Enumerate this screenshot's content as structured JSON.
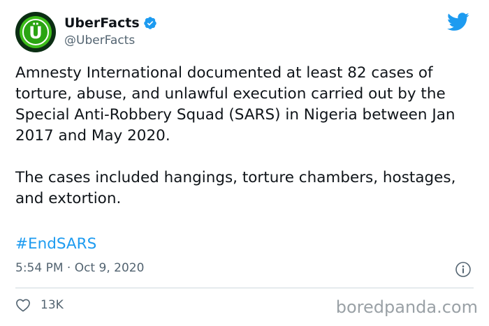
{
  "author": {
    "display_name": "UberFacts",
    "handle": "@UberFacts",
    "avatar_letter": "Ü",
    "verified": true
  },
  "tweet": {
    "paragraphs": [
      "Amnesty International documented at least 82 cases of torture, abuse, and unlawful execution carried out by the Special Anti-Robbery Squad (SARS) in Nigeria between Jan 2017 and May 2020.",
      "The cases included hangings, torture chambers, hostages, and extortion."
    ],
    "hashtag": "#EndSARS",
    "timestamp": "5:54 PM · Oct 9, 2020"
  },
  "engagement": {
    "likes": "13K"
  },
  "watermark": "boredpanda.com",
  "icons": {
    "bird": "twitter-bird-icon",
    "verified": "verified-badge-icon",
    "info": "info-icon",
    "heart": "heart-icon"
  },
  "colors": {
    "accent": "#1d9bf0",
    "text": "#0f1419",
    "muted": "#536471",
    "avatar_green": "#3dbd1a",
    "avatar_dark": "#0b2e13",
    "watermark": "#9aa1a6"
  }
}
